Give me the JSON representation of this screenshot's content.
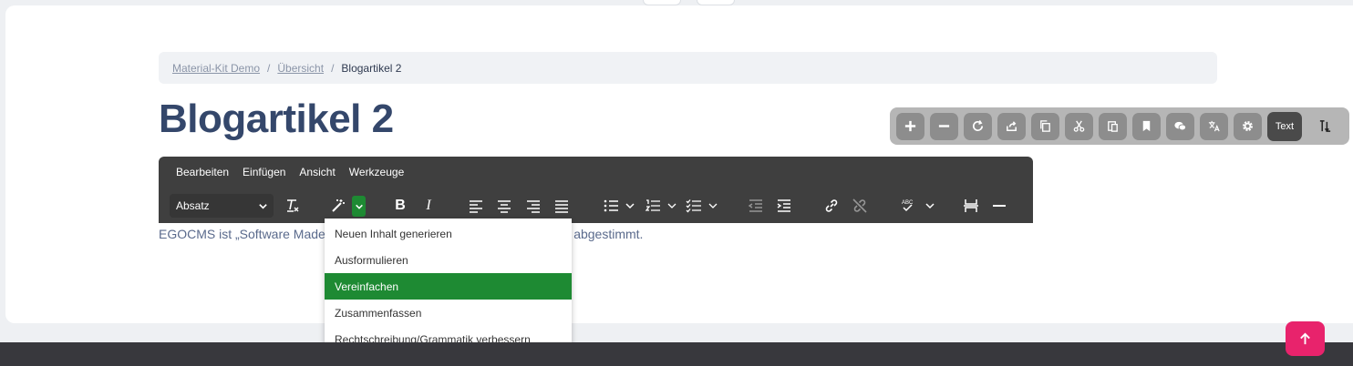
{
  "breadcrumb": {
    "items": [
      "Material-Kit Demo",
      "Übersicht"
    ],
    "current": "Blogartikel 2",
    "separator": "/"
  },
  "page": {
    "title": "Blogartikel 2",
    "content": "EGOCMS ist „Software Made                                                          d damit perfekt auf den Deutschland-Stack abgestimmt."
  },
  "admin_toolbar": {
    "text_label": "Text",
    "icons": [
      "plus-icon",
      "minus-icon",
      "reload-icon",
      "share-icon",
      "copy-icon",
      "cut-icon",
      "paste-icon",
      "bookmark-icon",
      "comments-icon",
      "translate-icon",
      "gear-icon",
      "sort-icon"
    ]
  },
  "editor": {
    "menu": [
      "Bearbeiten",
      "Einfügen",
      "Ansicht",
      "Werkzeuge"
    ],
    "block_format": "Absatz"
  },
  "ai_menu": {
    "items": [
      "Neuen Inhalt generieren",
      "Ausformulieren",
      "Vereinfachen",
      "Zusammenfassen",
      "Rechtschreibung/Grammatik verbessern"
    ],
    "active_index": 2
  },
  "colors": {
    "accent_green": "#1e8a33",
    "scroll_button": "#e8236c",
    "title": "#34476b"
  }
}
